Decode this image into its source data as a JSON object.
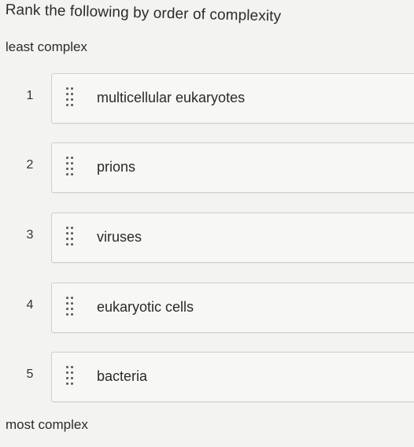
{
  "question": {
    "prompt": "Rank the following by order of complexity",
    "top_label": "least complex",
    "bottom_label": "most complex"
  },
  "items": [
    {
      "rank": "1",
      "label": "multicellular eukaryotes"
    },
    {
      "rank": "2",
      "label": "prions"
    },
    {
      "rank": "3",
      "label": "viruses"
    },
    {
      "rank": "4",
      "label": "eukaryotic cells"
    },
    {
      "rank": "5",
      "label": "bacteria"
    }
  ],
  "icons": {
    "drag_handle": "drag-handle-icon"
  },
  "colors": {
    "background": "#f3f3f1",
    "card_background": "#f7f7f5",
    "card_border": "#cfcfcb",
    "text": "#2b2b2b"
  }
}
